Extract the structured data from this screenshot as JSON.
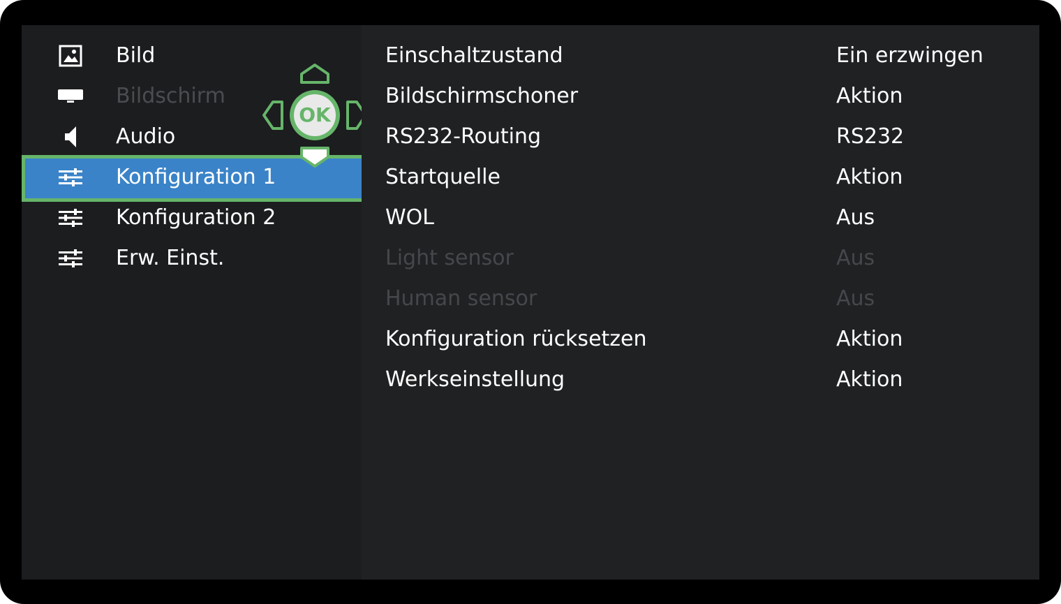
{
  "menu": {
    "items": [
      {
        "label": "Bild",
        "icon": "picture-icon",
        "disabled": false,
        "selected": false
      },
      {
        "label": "Bildschirm",
        "icon": "screen-icon",
        "disabled": true,
        "selected": false
      },
      {
        "label": "Audio",
        "icon": "speaker-icon",
        "disabled": false,
        "selected": false
      },
      {
        "label": "Konfiguration 1",
        "icon": "sliders-icon",
        "disabled": false,
        "selected": true
      },
      {
        "label": "Konfiguration 2",
        "icon": "sliders-icon",
        "disabled": false,
        "selected": false
      },
      {
        "label": "Erw. Einst.",
        "icon": "sliders-icon",
        "disabled": false,
        "selected": false
      }
    ]
  },
  "settings": {
    "rows": [
      {
        "label": "Einschaltzustand",
        "value": "Ein erzwingen",
        "disabled": false
      },
      {
        "label": "Bildschirmschoner",
        "value": "Aktion",
        "disabled": false
      },
      {
        "label": "RS232-Routing",
        "value": "RS232",
        "disabled": false
      },
      {
        "label": "Startquelle",
        "value": "Aktion",
        "disabled": false
      },
      {
        "label": "WOL",
        "value": "Aus",
        "disabled": false
      },
      {
        "label": "Light sensor",
        "value": "Aus",
        "disabled": true
      },
      {
        "label": "Human sensor",
        "value": "Aus",
        "disabled": true
      },
      {
        "label": "Konfiguration rücksetzen",
        "value": "Aktion",
        "disabled": false
      },
      {
        "label": "Werkseinstellung",
        "value": "Aktion",
        "disabled": false
      }
    ]
  },
  "remote": {
    "ok_label": "OK",
    "accent": "#66b56a"
  },
  "colors": {
    "selection": "#3a83c8",
    "highlight": "#66b56a",
    "disabled_text": "#4a4c50"
  }
}
